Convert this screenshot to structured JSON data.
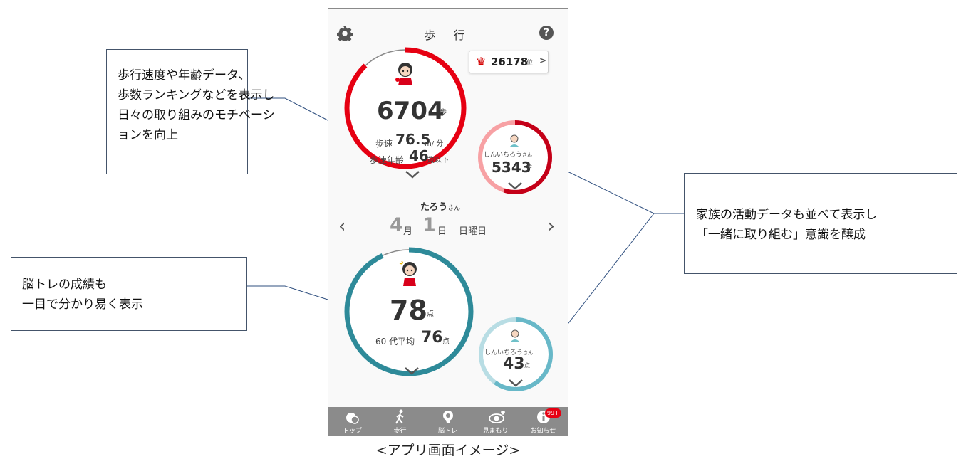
{
  "callouts": {
    "walk": [
      "歩行速度や年齢データ、",
      "歩数ランキングなどを表示し",
      "日々の取り組みのモチベーシ",
      "ョンを向上"
    ],
    "brain": [
      "脳トレの成績も",
      "一目で分かり易く表示"
    ],
    "family": [
      "家族の活動データも並べて表示し",
      "「一緒に取り組む」意識を醸成"
    ]
  },
  "app": {
    "title": "歩 行",
    "help_label": "?",
    "rank": {
      "value": "26178",
      "unit": "位",
      "arrow": ">"
    },
    "steps": {
      "value": "6704",
      "unit": "歩",
      "speed_label": "歩速",
      "speed_value": "76.5",
      "speed_unit": "m/ 分",
      "age_label": "歩速年齢",
      "age_value": "46",
      "age_unit": "歳以下"
    },
    "family_steps": {
      "name": "しんいちろう",
      "honorific": "さん",
      "value": "5343",
      "unit": "歩"
    },
    "user": {
      "name": "たろう",
      "honorific": "さん"
    },
    "date": {
      "month": "4",
      "month_unit": "月",
      "day": "1",
      "day_unit": "日",
      "weekday": "日曜日"
    },
    "nav": {
      "prev": "‹",
      "next": "›"
    },
    "brain": {
      "value": "78",
      "unit": "点",
      "avg_label": "60 代平均",
      "avg_value": "76",
      "avg_unit": "点"
    },
    "family_brain": {
      "name": "しんいちろう",
      "honorific": "さん",
      "value": "43",
      "unit": "点"
    },
    "tabs": [
      {
        "label": "トップ",
        "icon": "top-icon"
      },
      {
        "label": "歩行",
        "icon": "walk-icon"
      },
      {
        "label": "脳トレ",
        "icon": "brain-icon"
      },
      {
        "label": "見まもり",
        "icon": "watch-icon"
      },
      {
        "label": "お知らせ",
        "icon": "info-icon",
        "badge": "99+"
      }
    ],
    "progress": {
      "steps": 0.88,
      "family_steps": 0.55,
      "brain": 0.93,
      "family_brain": 0.6
    },
    "colors": {
      "steps": "#e60012",
      "steps_light": "#f7a1a4",
      "family_steps": "#c40018",
      "brain": "#2e8a99",
      "family_brain": "#68b8c8"
    }
  },
  "caption": "<アプリ画面イメージ>"
}
